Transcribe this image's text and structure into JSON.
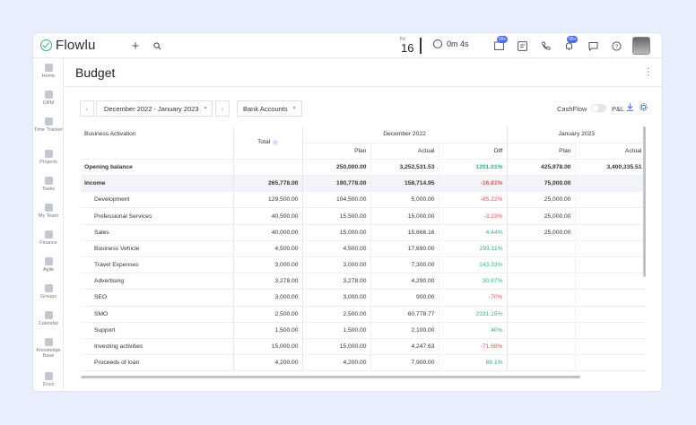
{
  "app": {
    "name": "Flowlu"
  },
  "topbar": {
    "date_day": "Fri",
    "date_num": "16",
    "timer": "0m 4s",
    "badge_tasks": "99+",
    "badge_notifications": "99+",
    "icons": [
      "plus-icon",
      "search-icon",
      "stopwatch-icon",
      "tasks-icon",
      "notes-icon",
      "phone-icon",
      "bell-icon",
      "chat-icon",
      "help-icon"
    ]
  },
  "sidebar": {
    "items": [
      {
        "label": "Home"
      },
      {
        "label": "CRM"
      },
      {
        "label": "Time Tracker"
      },
      {
        "label": "Projects"
      },
      {
        "label": "Tasks"
      },
      {
        "label": "My Team"
      },
      {
        "label": "Finance"
      },
      {
        "label": "Agile"
      },
      {
        "label": "Groups"
      },
      {
        "label": "Calendar"
      },
      {
        "label": "Knowledge Base"
      },
      {
        "label": "Docs"
      }
    ]
  },
  "page": {
    "title": "Budget"
  },
  "filters": {
    "period": "December 2022 - January 2023",
    "account": "Bank Accounts",
    "cashflow_label": "CashFlow",
    "pnl_label": "P&L"
  },
  "table": {
    "header_name": "Business Activation",
    "header_total": "Total",
    "months": [
      "December 2022",
      "January 2023"
    ],
    "cols": {
      "plan": "Plan",
      "actual": "Actual",
      "diff": "Diff"
    },
    "rows": [
      {
        "name": "Opening balance",
        "total": "",
        "dec_plan": "250,000.00",
        "dec_actual": "3,252,531.53",
        "dec_diff": "1201.01%",
        "jan_plan": "425,978.00",
        "jan_actual": "3,400,335.51"
      },
      {
        "name": "Income",
        "total": "265,778.00",
        "dec_plan": "190,778.00",
        "dec_actual": "158,714.95",
        "dec_diff": "-16.81%",
        "jan_plan": "75,000.00",
        "jan_actual": ""
      },
      {
        "name": "Development",
        "total": "129,500.00",
        "dec_plan": "104,500.00",
        "dec_actual": "5,000.00",
        "dec_diff": "-95.22%",
        "jan_plan": "25,000.00",
        "jan_actual": ""
      },
      {
        "name": "Professional Services",
        "total": "40,500.00",
        "dec_plan": "15,500.00",
        "dec_actual": "15,000.00",
        "dec_diff": "-3.23%",
        "jan_plan": "25,000.00",
        "jan_actual": ""
      },
      {
        "name": "Sales",
        "total": "40,000.00",
        "dec_plan": "15,000.00",
        "dec_actual": "15,666.16",
        "dec_diff": "4.44%",
        "jan_plan": "25,000.00",
        "jan_actual": ""
      },
      {
        "name": "Business Vehicle",
        "total": "4,500.00",
        "dec_plan": "4,500.00",
        "dec_actual": "17,690.00",
        "dec_diff": "293.11%",
        "jan_plan": "",
        "jan_actual": ""
      },
      {
        "name": "Travel Expenses",
        "total": "3,000.00",
        "dec_plan": "3,000.00",
        "dec_actual": "7,300.00",
        "dec_diff": "143.33%",
        "jan_plan": "",
        "jan_actual": ""
      },
      {
        "name": "Advertising",
        "total": "3,278.00",
        "dec_plan": "3,278.00",
        "dec_actual": "4,290.00",
        "dec_diff": "30.87%",
        "jan_plan": "",
        "jan_actual": ""
      },
      {
        "name": "SEO",
        "total": "3,000.00",
        "dec_plan": "3,000.00",
        "dec_actual": "900.00",
        "dec_diff": "-70%",
        "jan_plan": "",
        "jan_actual": ""
      },
      {
        "name": "SMO",
        "total": "2,500.00",
        "dec_plan": "2,500.00",
        "dec_actual": "60,778.77",
        "dec_diff": "2331.15%",
        "jan_plan": "",
        "jan_actual": ""
      },
      {
        "name": "Support",
        "total": "1,500.00",
        "dec_plan": "1,500.00",
        "dec_actual": "2,100.00",
        "dec_diff": "40%",
        "jan_plan": "",
        "jan_actual": ""
      },
      {
        "name": "Investing activities",
        "total": "15,000.00",
        "dec_plan": "15,000.00",
        "dec_actual": "4,247.63",
        "dec_diff": "-71.68%",
        "jan_plan": "",
        "jan_actual": ""
      },
      {
        "name": "Proceeds of loan",
        "total": "4,200.00",
        "dec_plan": "4,200.00",
        "dec_actual": "7,900.00",
        "dec_diff": "88.1%",
        "jan_plan": "",
        "jan_actual": ""
      }
    ]
  },
  "colors": {
    "accent": "#4a6cf7",
    "positive": "#2eb872",
    "negative": "#e5525a",
    "brand": "#2eb872"
  }
}
